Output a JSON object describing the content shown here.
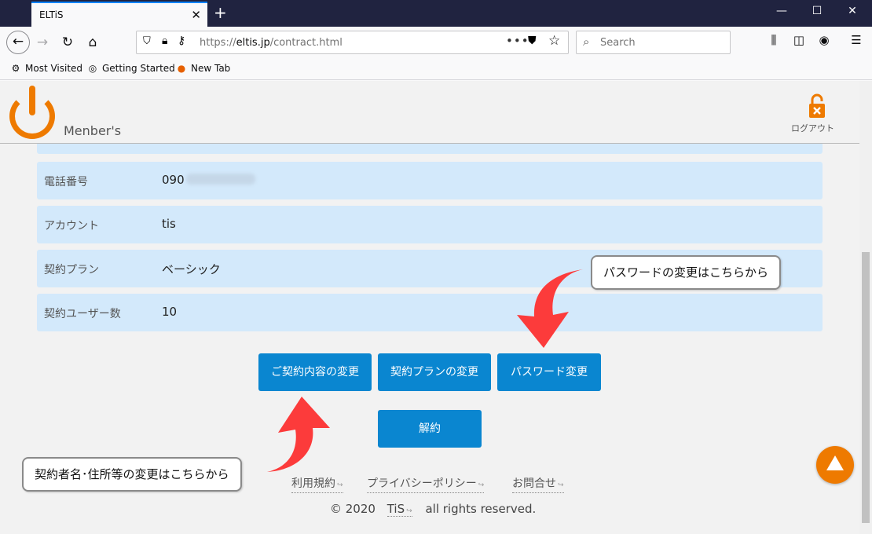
{
  "browser": {
    "tab_title": "ELTiS",
    "tab_close": "✕",
    "new_tab": "+",
    "window_minimize": "—",
    "window_maximize": "☐",
    "window_close": "✕",
    "url_prefix": "https://",
    "url_host": "eltis.jp",
    "url_path": "/contract.html",
    "url_more": "•••",
    "search_placeholder": "Search",
    "bookmarks": [
      {
        "label": "Most Visited",
        "icon": "gear-icon"
      },
      {
        "label": "Getting Started",
        "icon": "globe-icon"
      },
      {
        "label": "New Tab",
        "icon": "firefox-icon"
      }
    ]
  },
  "header": {
    "site_subtitle": "Menber's",
    "logout_label": "ログアウト",
    "brand_color": "#ee7a00"
  },
  "contract_rows": [
    {
      "label": "電話番号",
      "value": "090"
    },
    {
      "label": "アカウント",
      "value": "tis"
    },
    {
      "label": "契約プラン",
      "value": "ベーシック"
    },
    {
      "label": "契約ユーザー数",
      "value": "10"
    }
  ],
  "buttons": {
    "change_contract": "ご契約内容の変更",
    "change_plan": "契約プランの変更",
    "change_password": "パスワード変更",
    "cancel_contract": "解約",
    "color": "#0a86d0"
  },
  "callouts": {
    "password": "パスワードの変更はこちらから",
    "contract": "契約者名･住所等の変更はこちらから",
    "arrow_color": "#fc3b3b"
  },
  "footer": {
    "links": [
      "利用規約",
      "プライバシーポリシー",
      "お問合せ"
    ],
    "copyright_prefix": "© 2020",
    "copyright_link": "TiS",
    "copyright_suffix": "all rights reserved."
  }
}
